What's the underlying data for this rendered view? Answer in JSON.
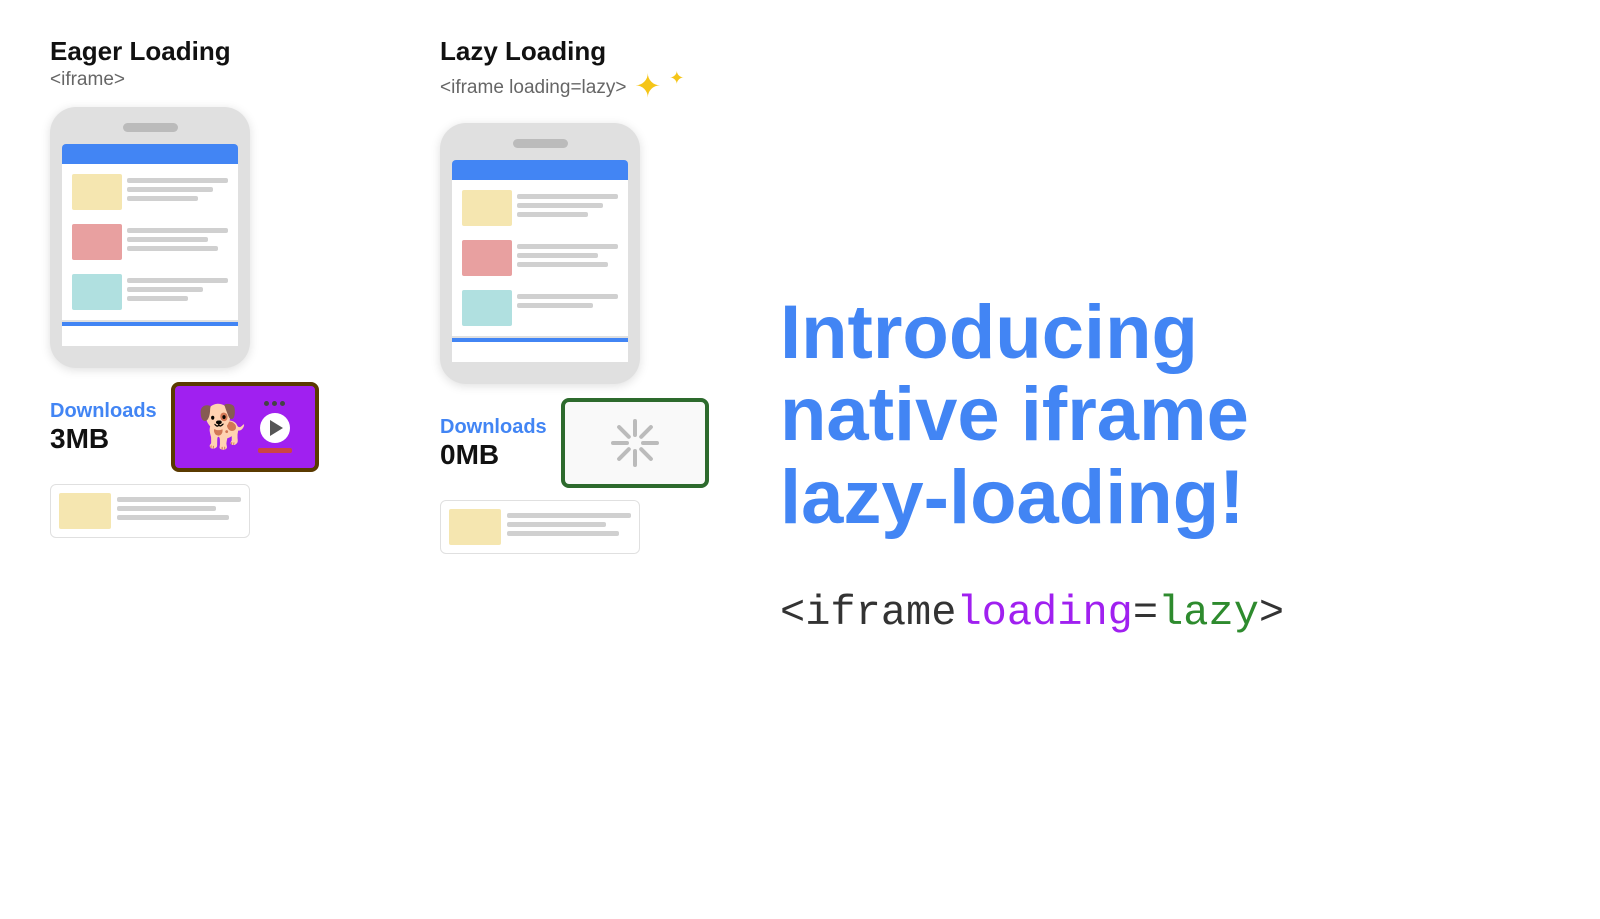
{
  "eager": {
    "title": "Eager Loading",
    "subtitle": "<iframe>",
    "downloads_label": "Downloads",
    "downloads_size": "3MB"
  },
  "lazy": {
    "title": "Lazy Loading",
    "subtitle": "<iframe loading=lazy>",
    "downloads_label": "Downloads",
    "downloads_size": "0MB"
  },
  "intro": {
    "heading_line1": "Introducing",
    "heading_line2": "native iframe",
    "heading_line3": "lazy-loading!"
  },
  "code": {
    "open": "<iframe ",
    "attr": "loading",
    "equals": "=",
    "value": "lazy",
    "close": ">"
  },
  "sparkle": "✦✦"
}
